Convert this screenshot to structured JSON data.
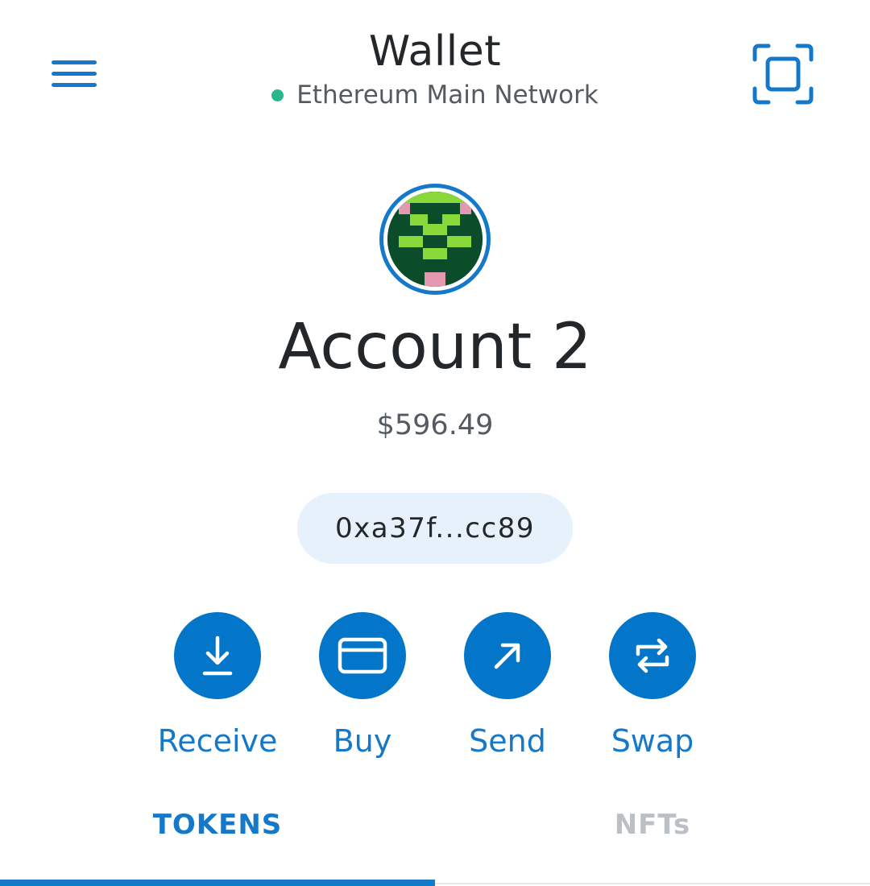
{
  "header": {
    "title": "Wallet",
    "network": "Ethereum Main Network",
    "network_status_color": "#29b68a"
  },
  "account": {
    "name": "Account 2",
    "balance": "$596.49",
    "address": "0xa37f...cc89"
  },
  "actions": [
    {
      "label": "Receive",
      "icon": "download-icon"
    },
    {
      "label": "Buy",
      "icon": "credit-card-icon"
    },
    {
      "label": "Send",
      "icon": "arrow-up-right-icon"
    },
    {
      "label": "Swap",
      "icon": "swap-arrows-icon"
    }
  ],
  "tabs": [
    {
      "label": "TOKENS",
      "active": true
    },
    {
      "label": "NFTs",
      "active": false
    }
  ],
  "colors": {
    "accent": "#1678c8",
    "button": "#0376c9",
    "pill_bg": "#e6f1fb",
    "inactive_tab": "#bbc0c5"
  }
}
